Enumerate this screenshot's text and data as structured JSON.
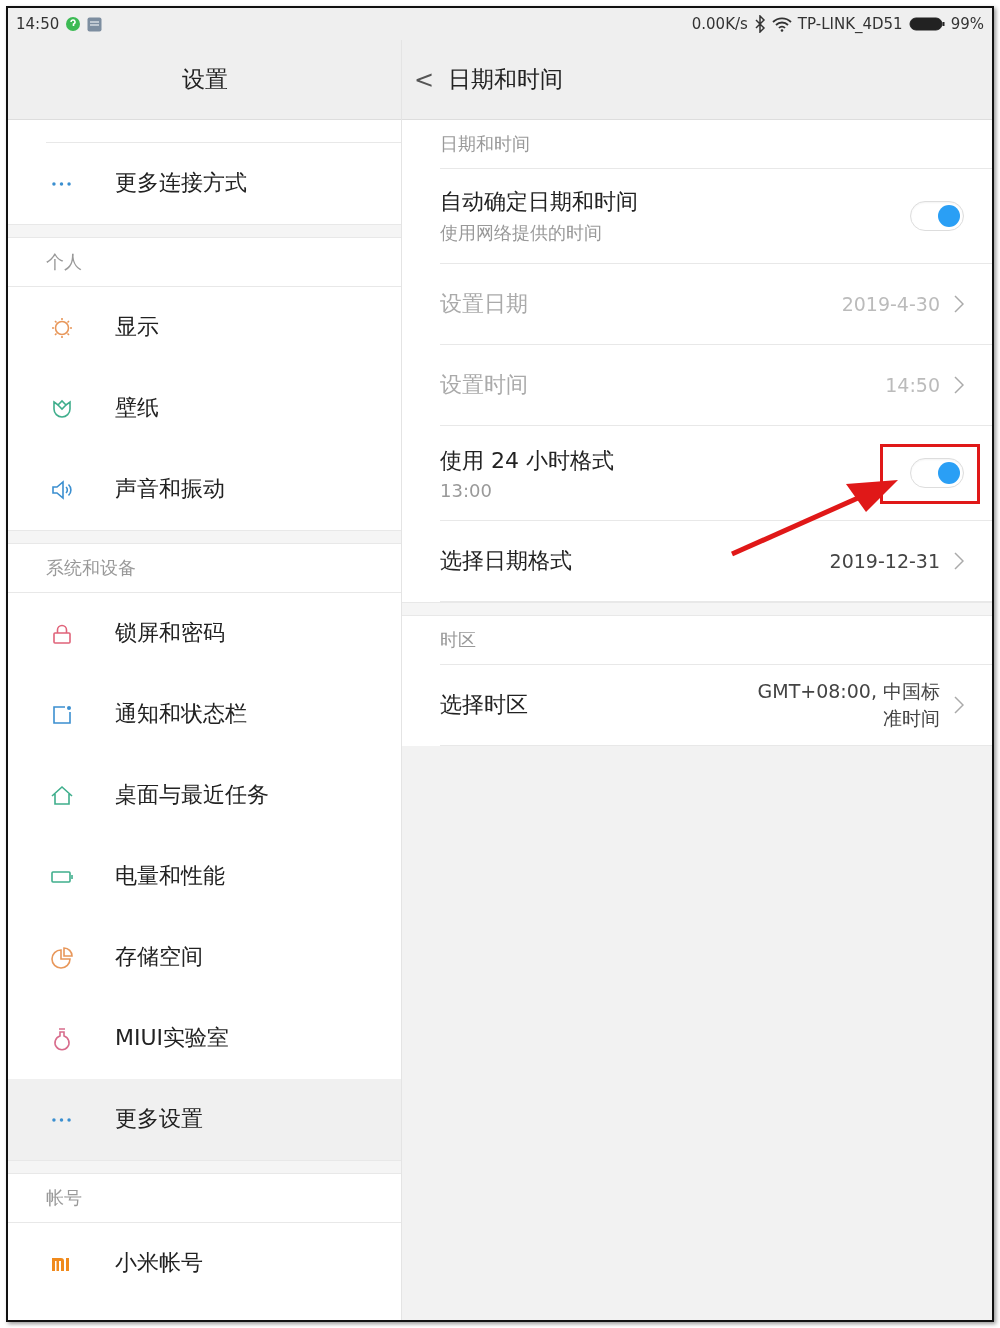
{
  "status_bar": {
    "time": "14:50",
    "speed": "0.00K/s",
    "network": "TP-LINK_4D51",
    "battery": "99%"
  },
  "sidebar": {
    "title": "设置",
    "sections": [
      {
        "items": [
          {
            "label": "更多连接方式",
            "selected": false
          }
        ]
      },
      {
        "title": "个人",
        "items": [
          {
            "label": "显示",
            "selected": false
          },
          {
            "label": "壁纸",
            "selected": false
          },
          {
            "label": "声音和振动",
            "selected": false
          }
        ]
      },
      {
        "title": "系统和设备",
        "items": [
          {
            "label": "锁屏和密码",
            "selected": false
          },
          {
            "label": "通知和状态栏",
            "selected": false
          },
          {
            "label": "桌面与最近任务",
            "selected": false
          },
          {
            "label": "电量和性能",
            "selected": false
          },
          {
            "label": "存储空间",
            "selected": false
          },
          {
            "label": "MIUI实验室",
            "selected": false
          },
          {
            "label": "更多设置",
            "selected": true
          }
        ]
      },
      {
        "title": "帐号",
        "items": [
          {
            "label": "小米帐号",
            "selected": false
          }
        ]
      }
    ]
  },
  "detail": {
    "back": "<",
    "title": "日期和时间",
    "sections": [
      {
        "title": "日期和时间",
        "rows": [
          {
            "kind": "toggle",
            "title": "自动确定日期和时间",
            "subtitle": "使用网络提供的时间",
            "on": true,
            "disabled": false
          },
          {
            "kind": "link",
            "title": "设置日期",
            "value": "2019-4-30",
            "disabled": true
          },
          {
            "kind": "link",
            "title": "设置时间",
            "value": "14:50",
            "disabled": true
          },
          {
            "kind": "toggle",
            "title": "使用 24 小时格式",
            "subtitle": "13:00",
            "on": true,
            "disabled": false,
            "highlighted": true
          },
          {
            "kind": "link",
            "title": "选择日期格式",
            "value": "2019-12-31",
            "disabled": false
          }
        ]
      },
      {
        "title": "时区",
        "rows": [
          {
            "kind": "link",
            "title": "选择时区",
            "value_lines": [
              "GMT+08:00, 中国标",
              "准时间"
            ],
            "disabled": false
          }
        ]
      }
    ]
  }
}
